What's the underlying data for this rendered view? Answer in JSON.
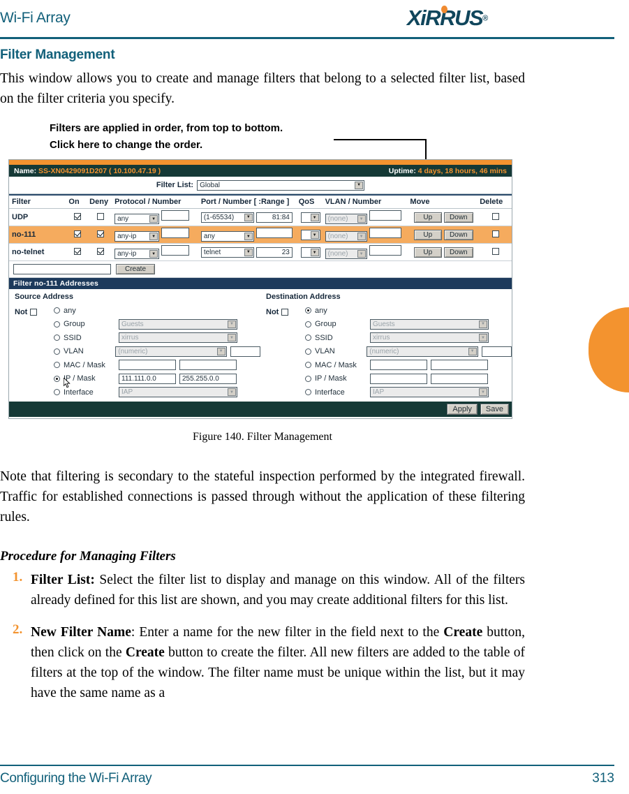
{
  "page": {
    "header_title": "Wi-Fi Array",
    "logo_text": "XiRRUS",
    "logo_reg": "®",
    "section_heading": "Filter Management",
    "intro": "This window allows you to create and manage filters that belong to a selected filter list, based on the filter criteria you specify.",
    "figure_caption": "Figure 140. Filter Management",
    "note_para": "Note that filtering is secondary to the stateful inspection performed by the integrated firewall. Traffic for established connections is passed through without the application of these filtering rules.",
    "sub_heading": "Procedure for Managing Filters",
    "footer_left": "Configuring the Wi-Fi Array",
    "footer_page": "313",
    "accent_orange": "#f3932f",
    "accent_teal": "#12607a"
  },
  "callout": {
    "line1": "Filters are applied in order, from top to bottom.",
    "line2": "Click here to change the order."
  },
  "procedure": [
    {
      "number": "1.",
      "html": "<b>Filter List:</b> Select the filter list to display and manage on this window. All of the filters already defined for this list are shown, and you may create additional filters for this list."
    },
    {
      "number": "2.",
      "html": "<b>New Filter Name</b>: Enter a name for the new filter in the field next to the <b>Create</b> button, then click on the <b>Create</b> button to create the filter. All new filters are added to the table of filters at the top of the window. The filter name must be unique within the list, but it may have the same name as a"
    }
  ],
  "ui": {
    "titlebar": {
      "name_label": "Name:",
      "device_name": "SS-XN0429091D207",
      "device_ip": "( 10.100.47.19 )",
      "uptime_label": "Uptime:",
      "uptime_value": "4 days, 18 hours, 46 mins"
    },
    "filter_list": {
      "label": "Filter List:",
      "value": "Global"
    },
    "table": {
      "columns": [
        "Filter",
        "On",
        "Deny",
        "Protocol / Number",
        "Port / Number [ :Range ]",
        "QoS",
        "VLAN / Number",
        "Move",
        "Delete"
      ],
      "rows": [
        {
          "name": "UDP",
          "on": true,
          "deny": false,
          "protocol": "any",
          "protocol_number": "",
          "port": "(1-65534)",
          "port_number": "81:84",
          "qos": "",
          "vlan": "(none)",
          "vlan_number": "",
          "move_up": "Up",
          "move_down": "Down",
          "delete": false,
          "highlighted": false
        },
        {
          "name": "no-111",
          "on": true,
          "deny": true,
          "protocol": "any-ip",
          "protocol_number": "",
          "port": "any",
          "port_number": "",
          "qos": "",
          "vlan": "(none)",
          "vlan_number": "",
          "move_up": "Up",
          "move_down": "Down",
          "delete": false,
          "highlighted": true
        },
        {
          "name": "no-telnet",
          "on": true,
          "deny": true,
          "protocol": "any-ip",
          "protocol_number": "",
          "port": "telnet",
          "port_number": "23",
          "qos": "",
          "vlan": "(none)",
          "vlan_number": "",
          "move_up": "Up",
          "move_down": "Down",
          "delete": false,
          "highlighted": false
        }
      ]
    },
    "create": {
      "new_filter_name": "",
      "button_label": "Create"
    },
    "addresses": {
      "bar_title": "Filter no-111  Addresses",
      "source": {
        "title": "Source Address",
        "not_label": "Not",
        "not_checked": false,
        "selected": "IP / Mask",
        "options": [
          {
            "label": "any",
            "selected": false,
            "control": "none",
            "value": ""
          },
          {
            "label": "Group",
            "selected": false,
            "control": "select",
            "value": "Guests"
          },
          {
            "label": "SSID",
            "selected": false,
            "control": "select",
            "value": "xirrus"
          },
          {
            "label": "VLAN",
            "selected": false,
            "control": "select+input",
            "value": "(numeric)",
            "value2": ""
          },
          {
            "label": "MAC / Mask",
            "selected": false,
            "control": "two-input",
            "value": "",
            "value2": ""
          },
          {
            "label": "IP / Mask",
            "selected": true,
            "control": "two-input",
            "value": "111.111.0.0",
            "value2": "255.255.0.0"
          },
          {
            "label": "Interface",
            "selected": false,
            "control": "select",
            "value": "IAP"
          }
        ]
      },
      "destination": {
        "title": "Destination Address",
        "not_label": "Not",
        "not_checked": false,
        "selected": "any",
        "options": [
          {
            "label": "any",
            "selected": true,
            "control": "none",
            "value": ""
          },
          {
            "label": "Group",
            "selected": false,
            "control": "select",
            "value": "Guests"
          },
          {
            "label": "SSID",
            "selected": false,
            "control": "select",
            "value": "xirrus"
          },
          {
            "label": "VLAN",
            "selected": false,
            "control": "select+input",
            "value": "(numeric)",
            "value2": ""
          },
          {
            "label": "MAC / Mask",
            "selected": false,
            "control": "two-input",
            "value": "",
            "value2": ""
          },
          {
            "label": "IP / Mask",
            "selected": false,
            "control": "two-input",
            "value": "",
            "value2": ""
          },
          {
            "label": "Interface",
            "selected": false,
            "control": "select",
            "value": "IAP"
          }
        ]
      }
    },
    "footer_buttons": {
      "apply": "Apply",
      "save": "Save"
    }
  }
}
